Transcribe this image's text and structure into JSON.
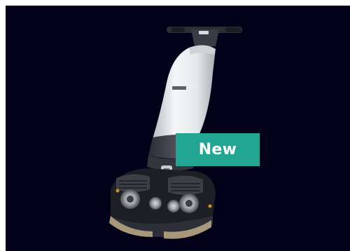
{
  "badge": {
    "label": "New",
    "color": "#23a594"
  },
  "image": {
    "subject": "floor-scrubber-machine",
    "background_color": "#03001a",
    "brand_text": "",
    "product_colors": {
      "tank": "#eaedee",
      "body": "#3d3f47",
      "base": "#23262d",
      "brush": "#a8987a"
    }
  }
}
